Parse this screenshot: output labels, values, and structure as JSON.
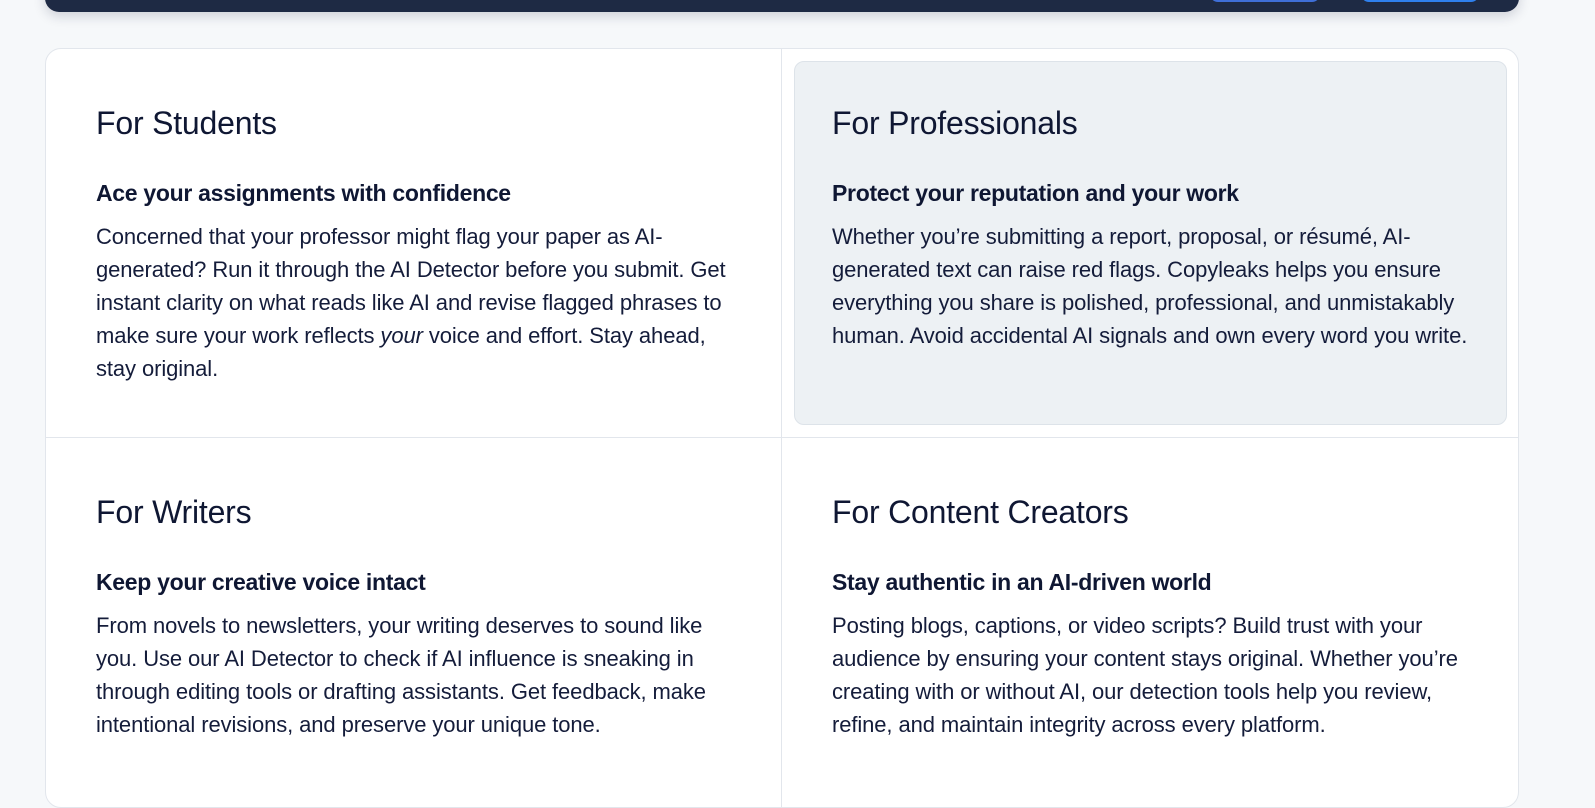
{
  "cards": [
    {
      "title": "For Students",
      "subtitle": "Ace your assignments with confidence",
      "body_before": "Concerned that your professor might flag your paper as AI-generated? Run it through the AI Detector before you submit. Get instant clarity on what reads like AI and revise flagged phrases to make sure your work reflects ",
      "body_emphasis": "your",
      "body_after": " voice and effort. Stay ahead, stay original."
    },
    {
      "title": "For Professionals",
      "subtitle": "Protect your reputation and your work",
      "body": "Whether you’re submitting a report, proposal, or résumé, AI-generated text can raise red flags. Copyleaks helps you ensure everything you share is polished, professional, and unmistakably human. Avoid accidental AI signals and own every word you write."
    },
    {
      "title": "For Writers",
      "subtitle": "Keep your creative voice intact",
      "body": "From novels to newsletters, your writing deserves to sound like you. Use our AI Detector to check if AI influence is sneaking in through editing tools or drafting assistants. Get feedback, make intentional revisions, and preserve your unique tone."
    },
    {
      "title": "For Content Creators",
      "subtitle": "Stay authentic in an AI-driven world",
      "body": "Posting blogs, captions, or video scripts? Build trust with your audience by ensuring your content stays original. Whether you’re creating with or without AI, our detection tools help you review, refine, and maintain integrity across every platform."
    }
  ],
  "colors": {
    "topbar": "#1e2a44",
    "highlight_card": "#edf1f4",
    "text": "#0f1733"
  }
}
